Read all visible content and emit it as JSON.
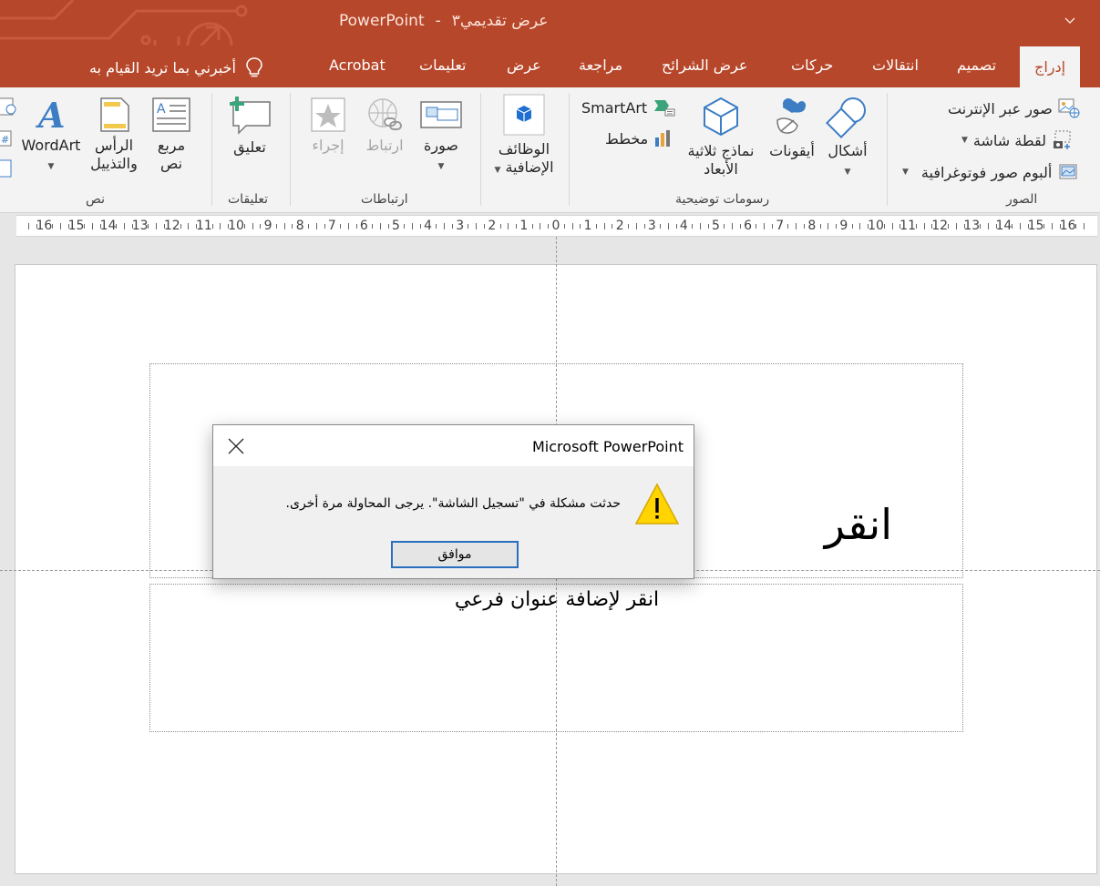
{
  "window": {
    "title_app": "PowerPoint",
    "title_separator": "-",
    "title_doc": "عرض تقديمي٣"
  },
  "tabs": [
    {
      "label": "إدراج",
      "active": true
    },
    {
      "label": "تصميم"
    },
    {
      "label": "انتقالات"
    },
    {
      "label": "حركات"
    },
    {
      "label": "عرض الشرائح"
    },
    {
      "label": "مراجعة"
    },
    {
      "label": "عرض"
    },
    {
      "label": "تعليمات"
    },
    {
      "label": "Acrobat"
    }
  ],
  "tell_me": "أخبرني بما تريد القيام به",
  "ribbon": {
    "images": {
      "group_label": "الصور",
      "online_pictures": "صور عبر الإنترنت",
      "screenshot": "لقطة شاشة",
      "photo_album": "ألبوم صور فوتوغرافية"
    },
    "illustrations": {
      "group_label": "رسومات توضيحية",
      "shapes": "أشكال",
      "icons": "أيقونات",
      "models_3d_line1": "نماذج ثلاثية",
      "models_3d_line2": "الأبعاد",
      "smartart": "SmartArt",
      "chart": "مخطط"
    },
    "addins": {
      "label_line1": "الوظائف",
      "label_line2": "الإضافية"
    },
    "links": {
      "group_label": "ارتباطات",
      "picture": "صورة",
      "link": "ارتباط",
      "action": "إجراء"
    },
    "comments": {
      "group_label": "تعليقات",
      "comment": "تعليق"
    },
    "text": {
      "group_label": "نص",
      "textbox_line1": "مربع",
      "textbox_line2": "نص",
      "header_line1": "الرأس",
      "header_line2": "والتذييل",
      "wordart": "WordArt"
    }
  },
  "ruler": {
    "labels": [
      "16",
      "15",
      "14",
      "13",
      "12",
      "11",
      "10",
      "9",
      "8",
      "7",
      "6",
      "5",
      "4",
      "3",
      "2",
      "1",
      "0",
      "1",
      "2",
      "3",
      "4",
      "5",
      "6",
      "7",
      "8",
      "9",
      "10",
      "11",
      "12",
      "13",
      "14",
      "15",
      "16"
    ]
  },
  "slide": {
    "title_placeholder": "انقر",
    "subtitle_placeholder": "انقر لإضافة عنوان فرعي"
  },
  "dialog": {
    "title": "Microsoft PowerPoint",
    "message": "حدثت مشكلة في \"تسجيل الشاشة\". يرجى المحاولة مرة أخرى.",
    "ok_label": "موافق"
  }
}
